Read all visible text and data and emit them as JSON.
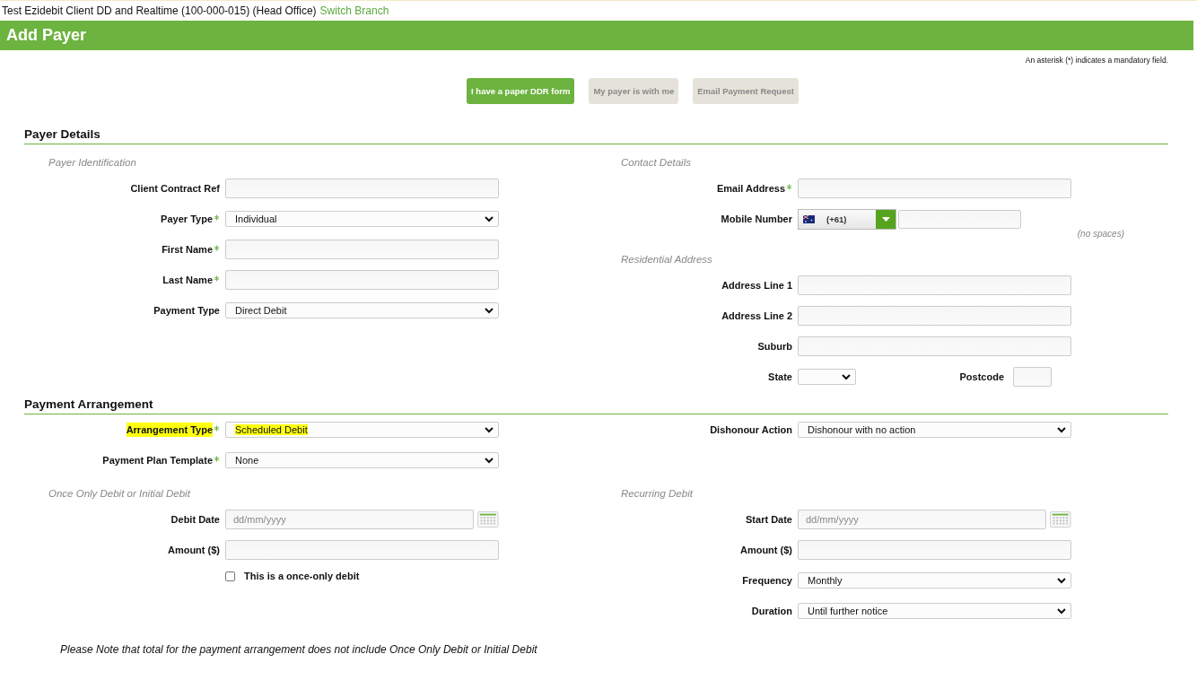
{
  "top_bar": {
    "client": "Test Ezidebit Client DD and Realtime (100-000-015) (Head Office)",
    "link": "Switch Branch"
  },
  "page_title": "Add Payer",
  "mandatory_note": "An asterisk (*) indicates a mandatory field.",
  "mode_buttons": [
    {
      "label": "I have a paper DDR form",
      "selected": true
    },
    {
      "label": "My payer is with me",
      "selected": false
    },
    {
      "label": "Email Payment Request",
      "selected": false
    }
  ],
  "sections": [
    {
      "title": "Payer Details",
      "rows": [
        {
          "columns": [
            [
              {
                "heading": "Payer Identification",
                "fields": [
                  {
                    "kind": "text",
                    "label": "Client Contract Ref",
                    "required": false
                  },
                  {
                    "kind": "select",
                    "label": "Payer Type",
                    "required": true,
                    "value": "Individual"
                  },
                  {
                    "kind": "text",
                    "label": "First Name",
                    "required": true
                  },
                  {
                    "kind": "text",
                    "label": "Last Name",
                    "required": true
                  },
                  {
                    "kind": "select",
                    "label": "Payment Type",
                    "required": false,
                    "value": "Direct Debit"
                  }
                ]
              }
            ],
            [
              {
                "heading": "Contact Details",
                "fields": [
                  {
                    "kind": "text",
                    "label": "Email Address",
                    "required": true
                  },
                  {
                    "kind": "phone",
                    "label": "Mobile Number",
                    "required": false,
                    "country_code": "(+61)",
                    "hint": "(no spaces)"
                  }
                ]
              },
              {
                "heading": "Residential Address",
                "fields": [
                  {
                    "kind": "text",
                    "label": "Address Line 1",
                    "required": false
                  },
                  {
                    "kind": "text",
                    "label": "Address Line 2",
                    "required": false
                  },
                  {
                    "kind": "text",
                    "label": "Suburb",
                    "required": false
                  },
                  {
                    "kind": "split",
                    "label": "State",
                    "required": false,
                    "second_label": "Postcode"
                  }
                ]
              }
            ]
          ]
        }
      ]
    },
    {
      "title": "Payment Arrangement",
      "rows": [
        {
          "columns": [
            [
              {
                "fields": [
                  {
                    "kind": "select",
                    "label": "Arrangement Type",
                    "required": true,
                    "value": "Scheduled Debit",
                    "highlighted": true
                  },
                  {
                    "kind": "select",
                    "label": "Payment Plan Template",
                    "required": true,
                    "value": "None",
                    "highlighted": false
                  }
                ]
              }
            ],
            [
              {
                "fields": [
                  {
                    "kind": "select",
                    "label": "Dishonour Action",
                    "required": false,
                    "value": "Dishonour with no action"
                  }
                ]
              }
            ]
          ]
        },
        {
          "columns": [
            [
              {
                "heading": "Once Only Debit or Initial Debit",
                "fields": [
                  {
                    "kind": "date",
                    "label": "Debit Date",
                    "required": false,
                    "placeholder": "dd/mm/yyyy"
                  },
                  {
                    "kind": "text",
                    "label": "Amount ($)",
                    "required": false
                  },
                  {
                    "kind": "checkbox",
                    "label": "This is a once-only debit",
                    "checked": false
                  }
                ]
              }
            ],
            [
              {
                "heading": "Recurring Debit",
                "fields": [
                  {
                    "kind": "date",
                    "label": "Start Date",
                    "required": false,
                    "placeholder": "dd/mm/yyyy"
                  },
                  {
                    "kind": "text",
                    "label": "Amount ($)",
                    "required": false
                  },
                  {
                    "kind": "select",
                    "label": "Frequency",
                    "required": false,
                    "value": "Monthly"
                  },
                  {
                    "kind": "select",
                    "label": "Duration",
                    "required": false,
                    "value": "Until further notice"
                  }
                ]
              }
            ]
          ]
        }
      ]
    }
  ],
  "footer_note": "Please Note that total for the payment arrangement does not include Once Only Debit or Initial Debit"
}
